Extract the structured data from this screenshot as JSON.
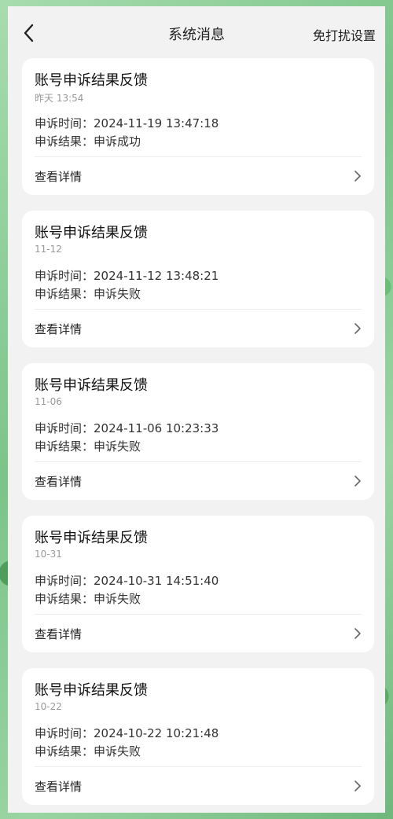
{
  "header": {
    "title": "系统消息",
    "dnd_label": "免打扰设置"
  },
  "messages": [
    {
      "title": "账号申诉结果反馈",
      "date": "昨天 13:54",
      "time_label": "申诉时间：",
      "time_value": "2024-11-19 13:47:18",
      "result_label": "申诉结果：",
      "result_value": "申诉成功",
      "detail_label": "查看详情"
    },
    {
      "title": "账号申诉结果反馈",
      "date": "11-12",
      "time_label": "申诉时间：",
      "time_value": "2024-11-12 13:48:21",
      "result_label": "申诉结果：",
      "result_value": "申诉失败",
      "detail_label": "查看详情"
    },
    {
      "title": "账号申诉结果反馈",
      "date": "11-06",
      "time_label": "申诉时间：",
      "time_value": "2024-11-06 10:23:33",
      "result_label": "申诉结果：",
      "result_value": "申诉失败",
      "detail_label": "查看详情"
    },
    {
      "title": "账号申诉结果反馈",
      "date": "10-31",
      "time_label": "申诉时间：",
      "time_value": "2024-10-31 14:51:40",
      "result_label": "申诉结果：",
      "result_value": "申诉失败",
      "detail_label": "查看详情"
    },
    {
      "title": "账号申诉结果反馈",
      "date": "10-22",
      "time_label": "申诉时间：",
      "time_value": "2024-10-22 10:21:48",
      "result_label": "申诉结果：",
      "result_value": "申诉失败",
      "detail_label": "查看详情"
    }
  ],
  "icons": {
    "back": "chevron-left-icon",
    "detail": "chevron-right-icon"
  }
}
